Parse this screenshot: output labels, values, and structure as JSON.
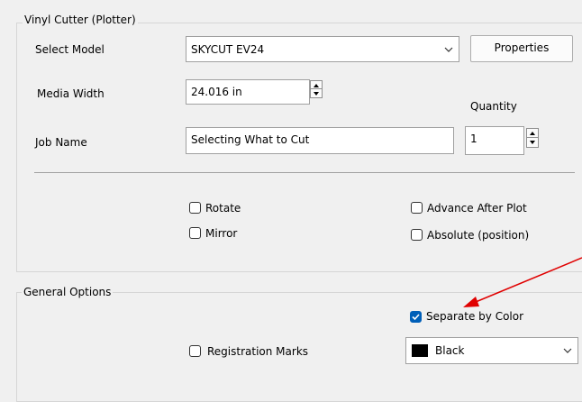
{
  "vinyl_group": {
    "title": "Vinyl Cutter (Plotter)",
    "select_model_label": "Select Model",
    "model_value": "SKYCUT EV24",
    "properties_label": "Properties",
    "media_width_label": "Media Width",
    "media_width_value": "24.016 in",
    "quantity_label": "Quantity",
    "quantity_value": "1",
    "job_name_label": "Job Name",
    "job_name_value": "Selecting What to  Cut",
    "rotate_label": "Rotate",
    "rotate_checked": false,
    "mirror_label": "Mirror",
    "mirror_checked": false,
    "advance_label": "Advance After Plot",
    "advance_checked": false,
    "absolute_label": "Absolute (position)",
    "absolute_checked": false
  },
  "general_group": {
    "title": "General Options",
    "separate_label": "Separate by Color",
    "separate_checked": true,
    "registration_label": "Registration Marks",
    "registration_checked": false,
    "color_value": "Black",
    "color_swatch": "#000000"
  },
  "annotation": {
    "arrow_color": "#e00000"
  }
}
